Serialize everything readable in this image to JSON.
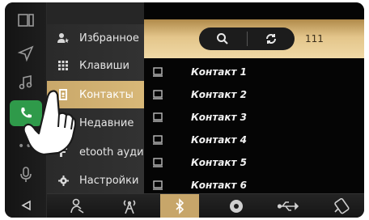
{
  "menu": {
    "items": [
      {
        "label": "Избранное",
        "icon": "person-star-icon"
      },
      {
        "label": "Клавиши",
        "icon": "keypad-icon"
      },
      {
        "label": "Контакты",
        "icon": "contacts-book-icon",
        "active": true
      },
      {
        "label": "Недавние",
        "icon": "recent-calls-icon"
      },
      {
        "label": "etooth ауди",
        "icon": "music-note-icon"
      },
      {
        "label": "Настройки",
        "icon": "gear-icon"
      }
    ]
  },
  "toolbar": {
    "search_icon": "search-icon",
    "sync_icon": "refresh-icon",
    "count": "111"
  },
  "contacts": [
    {
      "name": "Контакт 1"
    },
    {
      "name": "Контакт 2"
    },
    {
      "name": "Контакт 3"
    },
    {
      "name": "Контакт 4"
    },
    {
      "name": "Контакт 5"
    },
    {
      "name": "Контакт 6"
    }
  ],
  "left_rail": [
    "split-screen-icon",
    "navigation-icon",
    "music-icon",
    "phone-icon",
    "more-icon",
    "microphone-icon",
    "back-icon"
  ],
  "bottom_bar": [
    "driver-icon",
    "radio-antenna-icon",
    "bluetooth-icon",
    "disc-icon",
    "usb-icon",
    "phone-device-icon"
  ],
  "colors": {
    "accent_gold": "#d8b878",
    "phone_green": "#2f9a4a",
    "background": "#000000"
  }
}
